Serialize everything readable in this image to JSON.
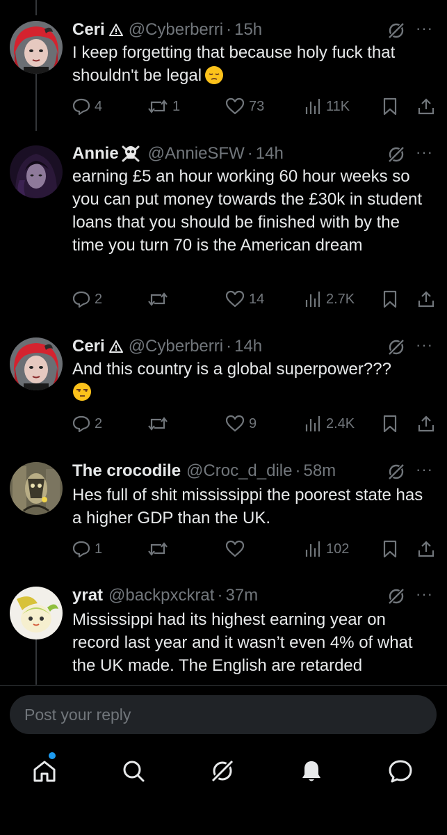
{
  "tweets": [
    {
      "name": "Ceri",
      "handle": "@Cyberberri",
      "dot": "·",
      "time": "15h",
      "text": "I keep forgetting that because holy fuck that shouldn't be legal",
      "emoji": "pensive-face-emoji",
      "replies": "4",
      "reposts": "1",
      "likes": "73",
      "views": "11K"
    },
    {
      "name": "Annie",
      "handle": "@AnnieSFW",
      "dot": "·",
      "time": "14h",
      "text": "earning £5 an hour working 60 hour weeks so you can put money towards the £30k in student loans that you should be finished with by the time you turn 70 is the American dream",
      "replies": "2",
      "reposts": "",
      "likes": "14",
      "views": "2.7K"
    },
    {
      "name": "Ceri",
      "handle": "@Cyberberri",
      "dot": "·",
      "time": "14h",
      "text": "And this country is a global superpower???",
      "emoji": "unamused-face-emoji",
      "replies": "2",
      "reposts": "",
      "likes": "9",
      "views": "2.4K"
    },
    {
      "name": "The crocodile",
      "handle": "@Croc_d_dile",
      "dot": "·",
      "time": "58m",
      "text": "Hes full of shit mississippi the poorest state has a higher GDP than the UK.",
      "replies": "1",
      "reposts": "",
      "likes": "",
      "views": "102"
    },
    {
      "name": "yrat",
      "handle": "@backpxckrat",
      "dot": "·",
      "time": "37m",
      "text": "Mississippi had its highest earning year on record last year and it wasn’t even 4% of what the UK made. The English are retarded"
    }
  ],
  "reply": {
    "placeholder": "Post your reply"
  },
  "more_label": "···",
  "colors": {
    "background": "#000000",
    "muted": "#71767b",
    "text": "#e7e9ea",
    "accent": "#1d9bf0"
  },
  "tabs": [
    "home-icon",
    "search-icon",
    "grok-icon",
    "notifications-icon",
    "messages-icon"
  ]
}
